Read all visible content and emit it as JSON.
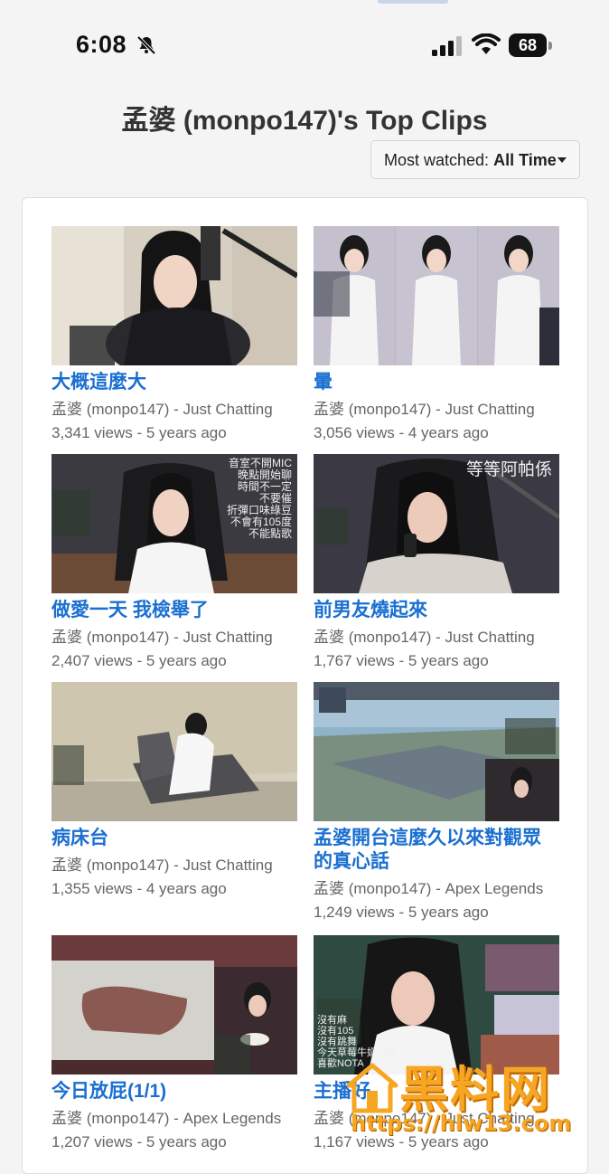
{
  "status_bar": {
    "time": "6:08",
    "battery": "68"
  },
  "page": {
    "title": "孟婆 (monpo147)'s Top Clips",
    "sort": {
      "prefix": "Most watched:",
      "value": "All Time"
    }
  },
  "clips": [
    {
      "title": "大概這麼大",
      "channel": "孟婆 (monpo147) - Just Chatting",
      "stats": "3,341 views - 5 years ago"
    },
    {
      "title": "暈",
      "channel": "孟婆 (monpo147) - Just Chatting",
      "stats": "3,056 views - 4 years ago"
    },
    {
      "title": "做愛一天 我檢舉了",
      "channel": "孟婆 (monpo147) - Just Chatting",
      "stats": "2,407 views - 5 years ago",
      "overlay": [
        "音室不開MIC",
        "晚點開始聊",
        "時間不一定",
        "不要催",
        "折彈口味綠豆",
        "不會有105度",
        "不能點歌"
      ]
    },
    {
      "title": "前男友燒起來",
      "channel": "孟婆 (monpo147) - Just Chatting",
      "stats": "1,767 views - 5 years ago",
      "overlay": [
        "等等阿帕係"
      ]
    },
    {
      "title": "病床台",
      "channel": "孟婆 (monpo147) - Just Chatting",
      "stats": "1,355 views - 4 years ago"
    },
    {
      "title": "孟婆開台這麼久以來對觀眾的真心話",
      "channel": "孟婆 (monpo147) - Apex Legends",
      "stats": "1,249 views - 5 years ago"
    },
    {
      "title": "今日放屁(1/1)",
      "channel": "孟婆 (monpo147) - Apex Legends",
      "stats": "1,207 views - 5 years ago"
    },
    {
      "title": "主播好",
      "channel": "孟婆 (monpo147) - Just Chatting",
      "stats": "1,167 views - 5 years ago",
      "overlay": [
        "沒有麻",
        "沒有105",
        "沒有跳舞",
        "今天草莓牛奶口味",
        "喜歡NOTA"
      ]
    }
  ],
  "watermark": {
    "brand": "黑料网",
    "url": "https://hlw13.com"
  },
  "colors": {
    "link": "#1a6fd1",
    "title": "#333333",
    "meta": "#666666"
  }
}
